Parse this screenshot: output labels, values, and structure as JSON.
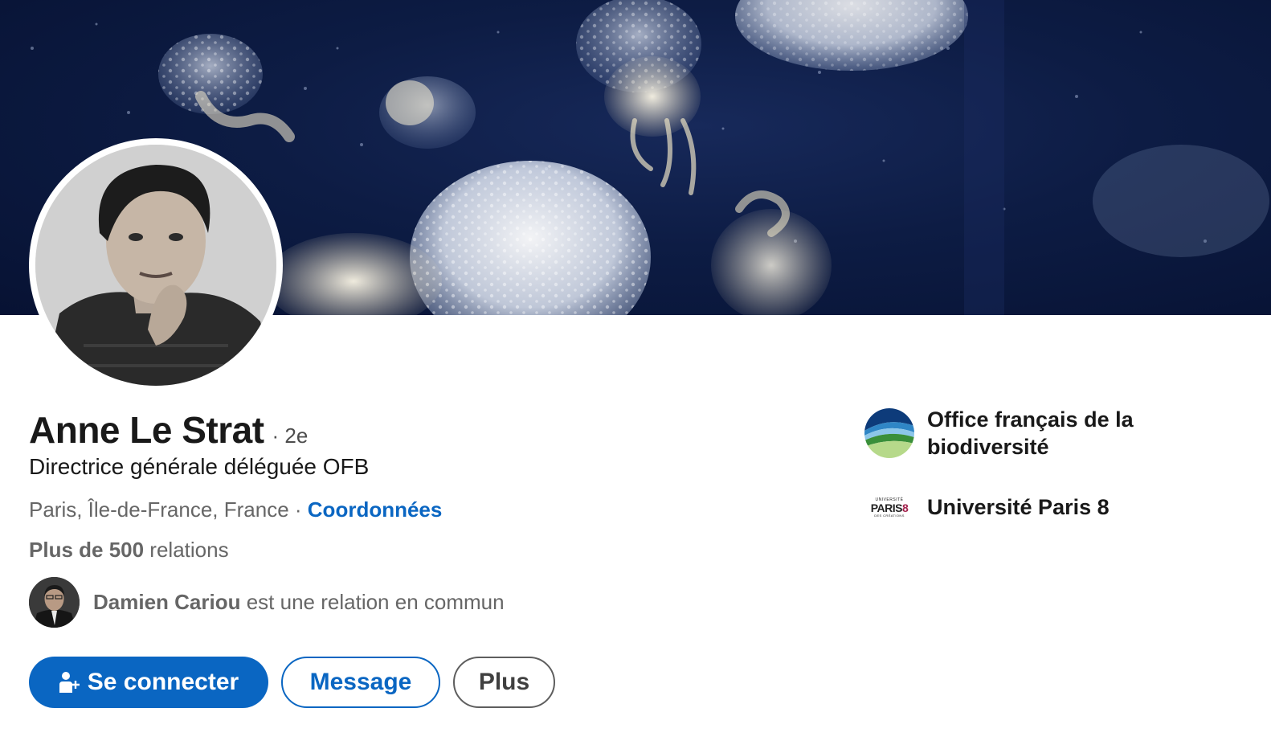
{
  "profile": {
    "name": "Anne Le Strat",
    "degree": "· 2e",
    "headline": "Directrice générale déléguée OFB",
    "location": "Paris, Île-de-France, France",
    "location_sep": " · ",
    "contact_link": "Coordonnées",
    "connections_bold": "Plus de 500",
    "connections_rest": " relations",
    "mutual_name": "Damien Cariou",
    "mutual_rest": " est une relation en commun"
  },
  "actions": {
    "connect_label": "Se connecter",
    "message_label": "Message",
    "more_label": "Plus"
  },
  "organizations": [
    {
      "name": "Office français de la biodiversité",
      "logo": "ofb-logo"
    },
    {
      "name": "Université Paris 8",
      "logo": "paris8-logo",
      "logo_text_top": "UNIVERSITÉ",
      "logo_text_main": "PARIS",
      "logo_text_digit": "8",
      "logo_text_bottom": "DES CRÉATIONS"
    }
  ],
  "icons": {
    "connect": "person-add-icon"
  },
  "colors": {
    "brand_blue": "#0a66c2",
    "text_primary": "#191919",
    "text_secondary": "#666666",
    "paris8_accent": "#a3224d"
  }
}
